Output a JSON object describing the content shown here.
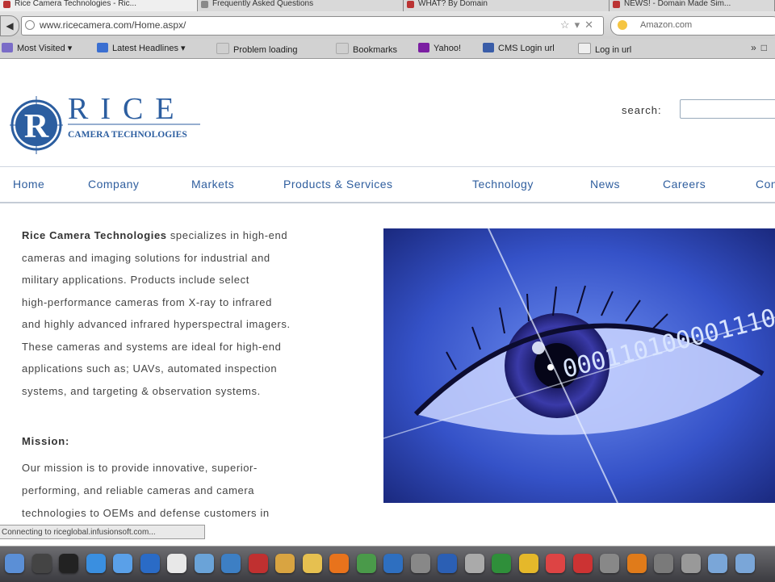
{
  "browser": {
    "tabs": [
      {
        "label": "Rice Camera Technologies - Ric...",
        "active": true
      },
      {
        "label": "Frequently Asked Questions",
        "active": false
      },
      {
        "label": "WHAT? By Domain",
        "active": false
      },
      {
        "label": "NEWS! - Domain Made Sim...",
        "active": false
      }
    ],
    "url": "www.ricecamera.com/Home.aspx/",
    "search_engine_placeholder": "Amazon.com",
    "bookmarks": [
      {
        "label": "Most Visited ▾",
        "icon": "star-icon",
        "color": "#7a6cc7"
      },
      {
        "label": "Latest Headlines ▾",
        "icon": "rss-icon",
        "color": "#3b6fd1"
      },
      {
        "label": "Problem loading",
        "icon": "page-icon",
        "color": "#cfcfcf"
      },
      {
        "label": "Bookmarks",
        "icon": "page-icon",
        "color": "#cfcfcf"
      },
      {
        "label": "Yahoo!",
        "icon": "yahoo-icon",
        "color": "#7b1fa2"
      },
      {
        "label": "CMS Login url",
        "icon": "r-icon",
        "color": "#3a5da8"
      },
      {
        "label": "Log in url",
        "icon": "page-icon",
        "color": "#eeeeee"
      }
    ],
    "status": "Connecting to riceglobal.infusionsoft.com..."
  },
  "site": {
    "logo_letter": "R",
    "logo_name": "RICE",
    "logo_tagline": "CAMERA TECHNOLOGIES",
    "brand_color": "#2c5ea0",
    "search_label": "search:",
    "nav": [
      "Home",
      "Company",
      "Markets",
      "Products & Services",
      "Technology",
      "News",
      "Careers",
      "Contact"
    ],
    "intro_brand": "Rice Camera Technologies",
    "intro_lines": [
      " specializes in high-end",
      "cameras and imaging solutions for industrial and",
      "military applications.  Products include select",
      "high-performance cameras from X-ray to infrared",
      "and highly advanced infrared hyperspectral imagers.",
      "These cameras and systems are ideal for high-end",
      "applications such as; UAVs, automated inspection",
      "systems, and targeting & observation systems."
    ],
    "mission_title": "Mission:",
    "mission_lines": [
      "Our mission is to provide innovative, superior-",
      "performing, and reliable cameras and camera",
      "technologies to OEMs and defense customers in"
    ],
    "hero_binary": "000110100001110"
  },
  "dock": {
    "icons": [
      "finder-icon",
      "dashboard-icon",
      "mail-icon",
      "safari-icon",
      "itunes-icon",
      "preview-icon",
      "calendar-icon",
      "photos-icon",
      "globe-icon",
      "app-icon",
      "app-icon",
      "app-icon",
      "firefox-icon",
      "app-icon",
      "app-icon",
      "app-icon",
      "word-icon",
      "app-icon",
      "excel-icon",
      "app-icon",
      "app-icon",
      "app-icon",
      "app-icon",
      "vlc-icon",
      "app-icon",
      "app-icon",
      "folder-icon",
      "folder-icon"
    ],
    "colors": [
      "#5b8fd6",
      "#444",
      "#222",
      "#3a8fe0",
      "#5aa0e8",
      "#2a6bc6",
      "#e8e8e8",
      "#6aa3d8",
      "#3d7fc4",
      "#c03030",
      "#d9a441",
      "#e6c050",
      "#e8731c",
      "#4a9a4a",
      "#2e6fc0",
      "#888",
      "#2b5fb4",
      "#aaa",
      "#2f8f3a",
      "#e5b82a",
      "#d44",
      "#c33",
      "#888",
      "#e07b1a",
      "#7a7a7a",
      "#999",
      "#7aa6d8",
      "#7aa6d8"
    ]
  }
}
